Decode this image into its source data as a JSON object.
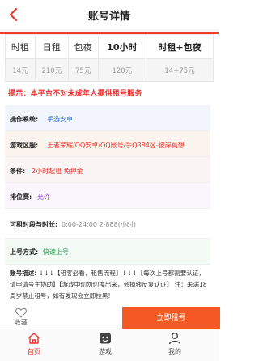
{
  "header": {
    "title": "账号详情"
  },
  "colors": {
    "accent": "#f23b2b",
    "button": "#f55a25",
    "blue": "#2a6fd6",
    "red": "#e8332a",
    "purple": "#9b3bd6",
    "green": "#1f9c4a"
  },
  "rent_table": {
    "headers": [
      "时租",
      "日租",
      "包夜",
      "10小时",
      "时租+包夜"
    ],
    "values": [
      "14元",
      "210元",
      "75元",
      "120元",
      "14+75元"
    ]
  },
  "notice": "提示：本平台不对未成年人提供租号服务",
  "details": {
    "system": {
      "label": "操作系统:",
      "value": "手游安卓"
    },
    "zone": {
      "label": "游戏区服:",
      "value": "王者荣耀/QQ安卓/QQ账号/手Q384区-彼岸莫想"
    },
    "condition": {
      "label": "条件:",
      "value": "2小时起租 免押金"
    },
    "ranked": {
      "label": "排位赛:",
      "value": "允许"
    },
    "time": {
      "label": "可租时段与时长:",
      "value": "0:00-24:00 2-888(小时)"
    },
    "login": {
      "label": "上号方式:",
      "value": "快速上号"
    }
  },
  "description": {
    "label": "账号描述:",
    "text": "↓↓↓【租客必看，租售流程】↓↓↓【每次上号都需要认证，请申请号主协助】【游戏中切勿切换出来，会掉线反复认证】 注：未满18周岁禁止租号，如有发现会立即拉黑!"
  },
  "actions": {
    "favorite": "收藏",
    "rent": "立即租号"
  },
  "tabs": [
    {
      "label": "首页",
      "icon": "home-icon",
      "active": true
    },
    {
      "label": "游戏",
      "icon": "game-icon",
      "active": false
    },
    {
      "label": "我的",
      "icon": "profile-icon",
      "active": false
    }
  ]
}
